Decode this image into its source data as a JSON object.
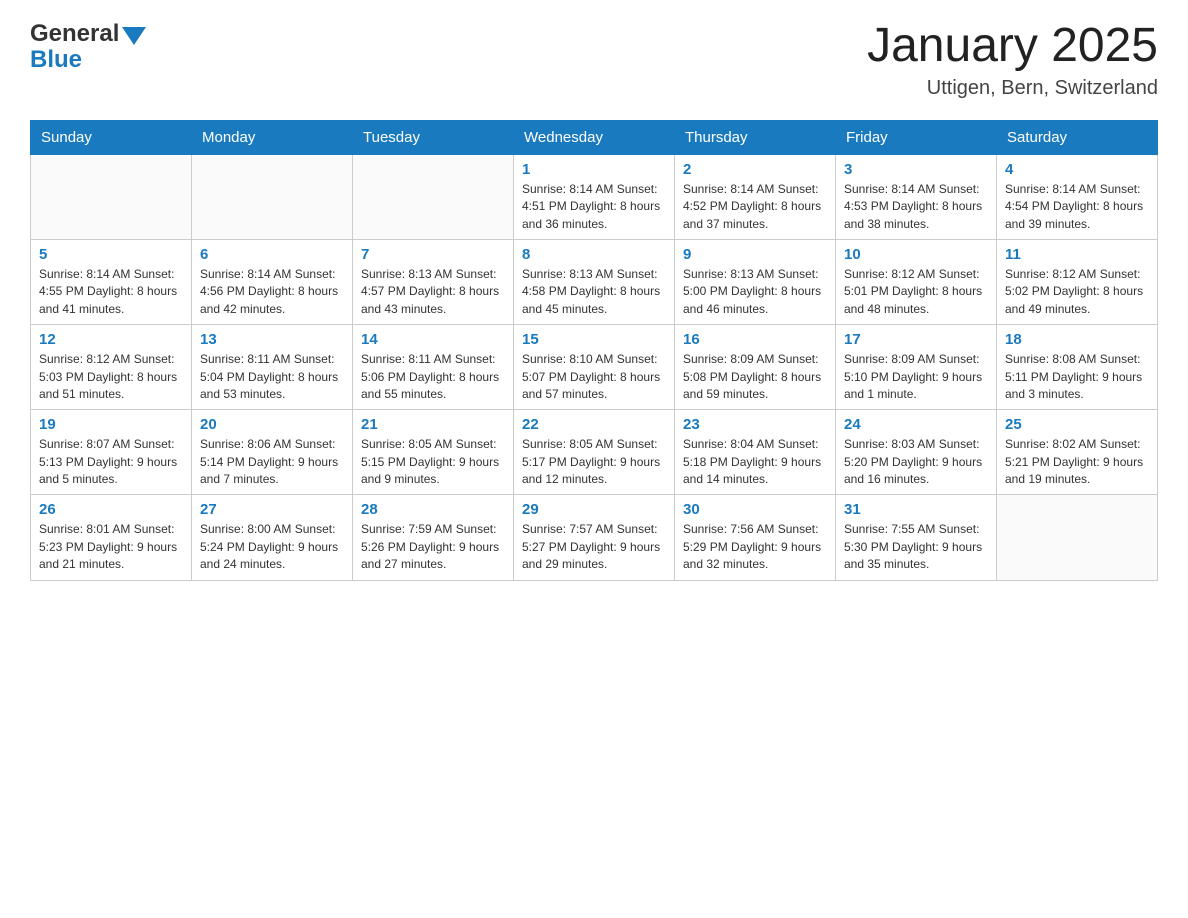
{
  "header": {
    "month_title": "January 2025",
    "location": "Uttigen, Bern, Switzerland",
    "logo_general": "General",
    "logo_blue": "Blue"
  },
  "calendar": {
    "days_of_week": [
      "Sunday",
      "Monday",
      "Tuesday",
      "Wednesday",
      "Thursday",
      "Friday",
      "Saturday"
    ],
    "weeks": [
      [
        {
          "day": "",
          "info": ""
        },
        {
          "day": "",
          "info": ""
        },
        {
          "day": "",
          "info": ""
        },
        {
          "day": "1",
          "info": "Sunrise: 8:14 AM\nSunset: 4:51 PM\nDaylight: 8 hours\nand 36 minutes."
        },
        {
          "day": "2",
          "info": "Sunrise: 8:14 AM\nSunset: 4:52 PM\nDaylight: 8 hours\nand 37 minutes."
        },
        {
          "day": "3",
          "info": "Sunrise: 8:14 AM\nSunset: 4:53 PM\nDaylight: 8 hours\nand 38 minutes."
        },
        {
          "day": "4",
          "info": "Sunrise: 8:14 AM\nSunset: 4:54 PM\nDaylight: 8 hours\nand 39 minutes."
        }
      ],
      [
        {
          "day": "5",
          "info": "Sunrise: 8:14 AM\nSunset: 4:55 PM\nDaylight: 8 hours\nand 41 minutes."
        },
        {
          "day": "6",
          "info": "Sunrise: 8:14 AM\nSunset: 4:56 PM\nDaylight: 8 hours\nand 42 minutes."
        },
        {
          "day": "7",
          "info": "Sunrise: 8:13 AM\nSunset: 4:57 PM\nDaylight: 8 hours\nand 43 minutes."
        },
        {
          "day": "8",
          "info": "Sunrise: 8:13 AM\nSunset: 4:58 PM\nDaylight: 8 hours\nand 45 minutes."
        },
        {
          "day": "9",
          "info": "Sunrise: 8:13 AM\nSunset: 5:00 PM\nDaylight: 8 hours\nand 46 minutes."
        },
        {
          "day": "10",
          "info": "Sunrise: 8:12 AM\nSunset: 5:01 PM\nDaylight: 8 hours\nand 48 minutes."
        },
        {
          "day": "11",
          "info": "Sunrise: 8:12 AM\nSunset: 5:02 PM\nDaylight: 8 hours\nand 49 minutes."
        }
      ],
      [
        {
          "day": "12",
          "info": "Sunrise: 8:12 AM\nSunset: 5:03 PM\nDaylight: 8 hours\nand 51 minutes."
        },
        {
          "day": "13",
          "info": "Sunrise: 8:11 AM\nSunset: 5:04 PM\nDaylight: 8 hours\nand 53 minutes."
        },
        {
          "day": "14",
          "info": "Sunrise: 8:11 AM\nSunset: 5:06 PM\nDaylight: 8 hours\nand 55 minutes."
        },
        {
          "day": "15",
          "info": "Sunrise: 8:10 AM\nSunset: 5:07 PM\nDaylight: 8 hours\nand 57 minutes."
        },
        {
          "day": "16",
          "info": "Sunrise: 8:09 AM\nSunset: 5:08 PM\nDaylight: 8 hours\nand 59 minutes."
        },
        {
          "day": "17",
          "info": "Sunrise: 8:09 AM\nSunset: 5:10 PM\nDaylight: 9 hours\nand 1 minute."
        },
        {
          "day": "18",
          "info": "Sunrise: 8:08 AM\nSunset: 5:11 PM\nDaylight: 9 hours\nand 3 minutes."
        }
      ],
      [
        {
          "day": "19",
          "info": "Sunrise: 8:07 AM\nSunset: 5:13 PM\nDaylight: 9 hours\nand 5 minutes."
        },
        {
          "day": "20",
          "info": "Sunrise: 8:06 AM\nSunset: 5:14 PM\nDaylight: 9 hours\nand 7 minutes."
        },
        {
          "day": "21",
          "info": "Sunrise: 8:05 AM\nSunset: 5:15 PM\nDaylight: 9 hours\nand 9 minutes."
        },
        {
          "day": "22",
          "info": "Sunrise: 8:05 AM\nSunset: 5:17 PM\nDaylight: 9 hours\nand 12 minutes."
        },
        {
          "day": "23",
          "info": "Sunrise: 8:04 AM\nSunset: 5:18 PM\nDaylight: 9 hours\nand 14 minutes."
        },
        {
          "day": "24",
          "info": "Sunrise: 8:03 AM\nSunset: 5:20 PM\nDaylight: 9 hours\nand 16 minutes."
        },
        {
          "day": "25",
          "info": "Sunrise: 8:02 AM\nSunset: 5:21 PM\nDaylight: 9 hours\nand 19 minutes."
        }
      ],
      [
        {
          "day": "26",
          "info": "Sunrise: 8:01 AM\nSunset: 5:23 PM\nDaylight: 9 hours\nand 21 minutes."
        },
        {
          "day": "27",
          "info": "Sunrise: 8:00 AM\nSunset: 5:24 PM\nDaylight: 9 hours\nand 24 minutes."
        },
        {
          "day": "28",
          "info": "Sunrise: 7:59 AM\nSunset: 5:26 PM\nDaylight: 9 hours\nand 27 minutes."
        },
        {
          "day": "29",
          "info": "Sunrise: 7:57 AM\nSunset: 5:27 PM\nDaylight: 9 hours\nand 29 minutes."
        },
        {
          "day": "30",
          "info": "Sunrise: 7:56 AM\nSunset: 5:29 PM\nDaylight: 9 hours\nand 32 minutes."
        },
        {
          "day": "31",
          "info": "Sunrise: 7:55 AM\nSunset: 5:30 PM\nDaylight: 9 hours\nand 35 minutes."
        },
        {
          "day": "",
          "info": ""
        }
      ]
    ]
  }
}
